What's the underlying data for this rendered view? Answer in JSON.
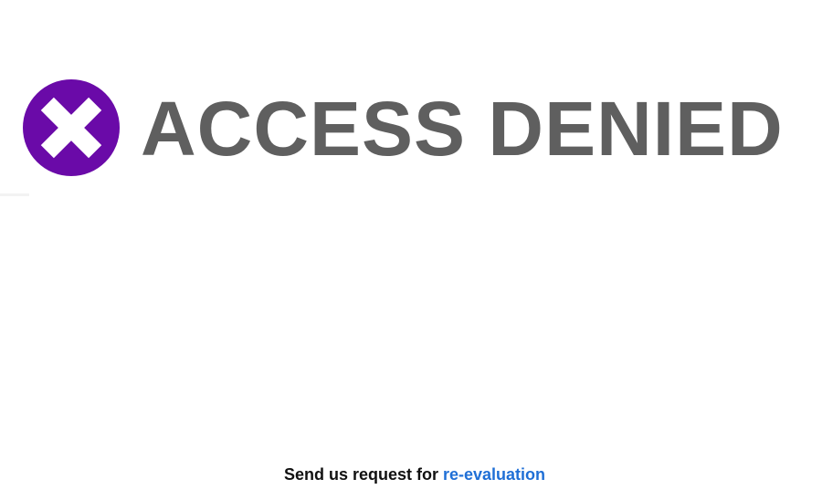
{
  "banner": {
    "title": "ACCESS DENIED",
    "icon": "x-circle-icon",
    "icon_color": "#6a0aa8",
    "title_color": "#5f5f5f"
  },
  "footer": {
    "text": "Send us request for",
    "link_label": "re-evaluation",
    "link_color": "#1f6fd6"
  }
}
